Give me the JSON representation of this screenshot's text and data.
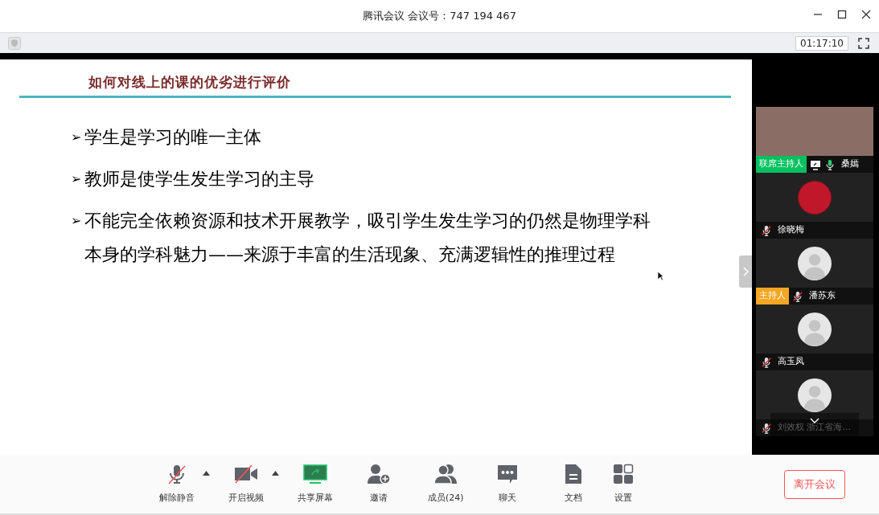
{
  "window": {
    "title": "腾讯会议 会议号：747 194 467"
  },
  "top_bar": {
    "timer": "01:17:10"
  },
  "slide": {
    "title": "如何对线上的课的优劣进行评价",
    "bullets": [
      {
        "marker": "➢",
        "text": "学生是学习的唯一主体"
      },
      {
        "marker": "➢",
        "text": "教师是使学生发生学习的主导"
      },
      {
        "marker": "➢",
        "text": "不能完全依赖资源和技术开展教学，吸引学生发生学习的仍然是物理学科本身的学科魅力——来源于丰富的生活现象、充满逻辑性的推理过程"
      }
    ]
  },
  "participants": [
    {
      "kind": "video",
      "role": "联席主持人",
      "color": "#07c160",
      "sharing": true,
      "muted": false,
      "name": "桑嫣"
    },
    {
      "kind": "avatar",
      "muted": true,
      "name": "徐晓梅"
    },
    {
      "kind": "default",
      "role": "主持人",
      "color": "#f5a623",
      "muted": true,
      "name": "潘苏东"
    },
    {
      "kind": "default",
      "muted": true,
      "name": "高玉凤"
    },
    {
      "kind": "default",
      "muted": true,
      "name": "刘效权 浙江省海..."
    }
  ],
  "toolbar": [
    {
      "kind": "mic",
      "label": "解除静音",
      "off": true,
      "menu": true
    },
    {
      "kind": "video",
      "label": "开启视频",
      "off": true,
      "menu": true
    },
    {
      "kind": "share",
      "label": "共享屏幕"
    },
    {
      "kind": "invite",
      "label": "邀请"
    },
    {
      "kind": "members",
      "label": "成员(24)"
    },
    {
      "kind": "chat",
      "label": "聊天"
    },
    {
      "kind": "doc",
      "label": "文档"
    },
    {
      "kind": "settings",
      "label": "设置"
    }
  ],
  "leave_button": "离开会议"
}
